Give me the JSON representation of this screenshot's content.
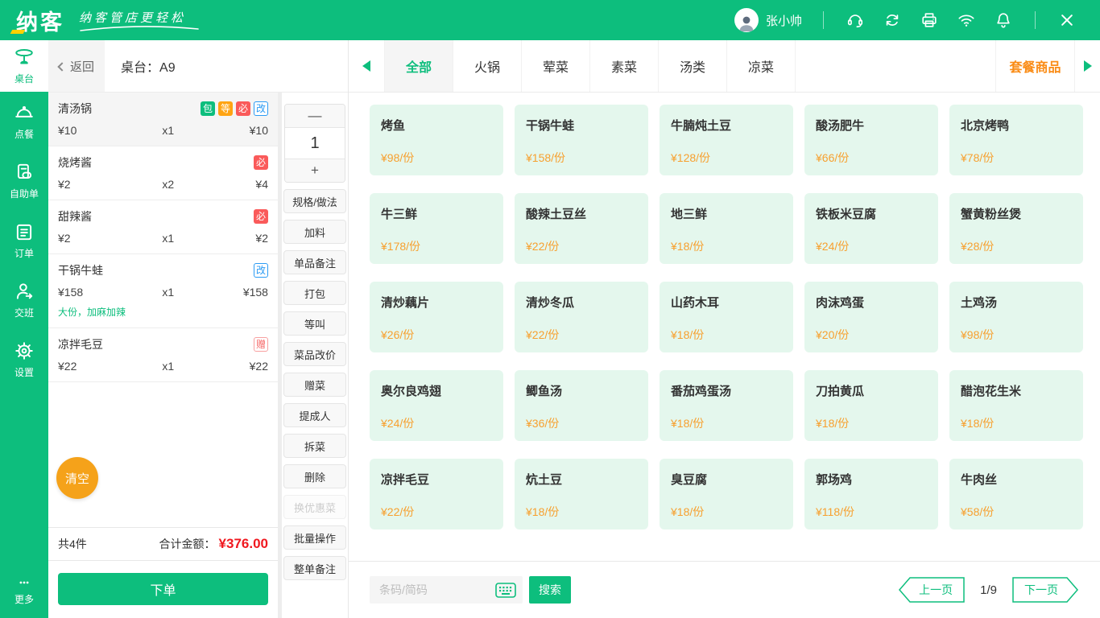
{
  "colors": {
    "primary_green": "#0dbe7d",
    "price_orange": "#f7a02f",
    "combo_orange": "#fa8c16",
    "total_red": "#f0181f",
    "badge_green": "#0dbe7d",
    "badge_orange": "#ffa413",
    "badge_red": "#fa5a5a",
    "badge_blue": "#2b9bf4",
    "card_bg": "#e4f7ed",
    "clear_orange": "#f5a21a"
  },
  "topbar": {
    "logo": "纳客",
    "slogan": "纳客管店更轻松",
    "user_name": "张小帅",
    "icons": [
      "customer-service",
      "sync",
      "printer",
      "wifi",
      "notification",
      "close"
    ]
  },
  "sidebar": {
    "items": [
      {
        "label": "桌台",
        "active": true
      },
      {
        "label": "点餐"
      },
      {
        "label": "自助单"
      },
      {
        "label": "订单"
      },
      {
        "label": "交班"
      },
      {
        "label": "设置"
      }
    ],
    "more_label": "更多"
  },
  "order_panel": {
    "back_label": "返回",
    "table_label": "桌台：",
    "table_value": "A9",
    "items": [
      {
        "name": "清汤锅",
        "price": "¥10",
        "qty": "x1",
        "total": "¥10",
        "badges": [
          "包",
          "等",
          "必",
          "改"
        ],
        "selected": true
      },
      {
        "name": "烧烤酱",
        "price": "¥2",
        "qty": "x2",
        "total": "¥4",
        "badges": [
          "必"
        ]
      },
      {
        "name": "甜辣酱",
        "price": "¥2",
        "qty": "x1",
        "total": "¥2",
        "badges": [
          "必"
        ]
      },
      {
        "name": "干锅牛蛙",
        "price": "¥158",
        "qty": "x1",
        "total": "¥158",
        "badges": [
          "改"
        ],
        "note": "大份，加麻加辣"
      },
      {
        "name": "凉拌毛豆",
        "price": "¥22",
        "qty": "x1",
        "total": "¥22",
        "badges": [
          "赠"
        ]
      }
    ],
    "clear_label": "清空",
    "count_label": "共4件",
    "total_label": "合计金额：",
    "total_value": "¥376.00",
    "submit_label": "下单"
  },
  "actions": {
    "minus_label": "—",
    "quantity": "1",
    "plus_label": "+",
    "buttons": [
      {
        "label": "规格/做法"
      },
      {
        "label": "加料"
      },
      {
        "label": "单品备注"
      },
      {
        "label": "打包"
      },
      {
        "label": "等叫"
      },
      {
        "label": "菜品改价"
      },
      {
        "label": "赠菜"
      },
      {
        "label": "提成人"
      },
      {
        "label": "拆菜"
      },
      {
        "label": "删除"
      },
      {
        "label": "换优惠菜",
        "disabled": true
      },
      {
        "label": "批量操作"
      },
      {
        "label": "整单备注"
      }
    ]
  },
  "categories": {
    "tabs": [
      {
        "label": "全部",
        "active": true
      },
      {
        "label": "火锅"
      },
      {
        "label": "荤菜"
      },
      {
        "label": "素菜"
      },
      {
        "label": "汤类"
      },
      {
        "label": "凉菜"
      }
    ],
    "combo_label": "套餐商品"
  },
  "menu": {
    "items": [
      {
        "name": "烤鱼",
        "price": "¥98/份"
      },
      {
        "name": "干锅牛蛙",
        "price": "¥158/份"
      },
      {
        "name": "牛腩炖土豆",
        "price": "¥128/份"
      },
      {
        "name": "酸汤肥牛",
        "price": "¥66/份"
      },
      {
        "name": "北京烤鸭",
        "price": "¥78/份"
      },
      {
        "name": "牛三鲜",
        "price": "¥178/份"
      },
      {
        "name": "酸辣土豆丝",
        "price": "¥22/份"
      },
      {
        "name": "地三鲜",
        "price": "¥18/份"
      },
      {
        "name": "铁板米豆腐",
        "price": "¥24/份"
      },
      {
        "name": "蟹黄粉丝煲",
        "price": "¥28/份"
      },
      {
        "name": "清炒藕片",
        "price": "¥26/份"
      },
      {
        "name": "清炒冬瓜",
        "price": "¥22/份"
      },
      {
        "name": "山药木耳",
        "price": "¥18/份"
      },
      {
        "name": "肉沫鸡蛋",
        "price": "¥20/份"
      },
      {
        "name": "土鸡汤",
        "price": "¥98/份"
      },
      {
        "name": "奥尔良鸡翅",
        "price": "¥24/份"
      },
      {
        "name": "鲫鱼汤",
        "price": "¥36/份"
      },
      {
        "name": "番茄鸡蛋汤",
        "price": "¥18/份"
      },
      {
        "name": "刀拍黄瓜",
        "price": "¥18/份"
      },
      {
        "name": "醋泡花生米",
        "price": "¥18/份"
      },
      {
        "name": "凉拌毛豆",
        "price": "¥22/份"
      },
      {
        "name": "炕土豆",
        "price": "¥18/份"
      },
      {
        "name": "臭豆腐",
        "price": "¥18/份"
      },
      {
        "name": "郭场鸡",
        "price": "¥118/份"
      },
      {
        "name": "牛肉丝",
        "price": "¥58/份"
      }
    ]
  },
  "footer": {
    "search_placeholder": "条码/简码",
    "search_button": "搜索",
    "prev_label": "上一页",
    "page_indicator": "1/9",
    "next_label": "下一页"
  }
}
